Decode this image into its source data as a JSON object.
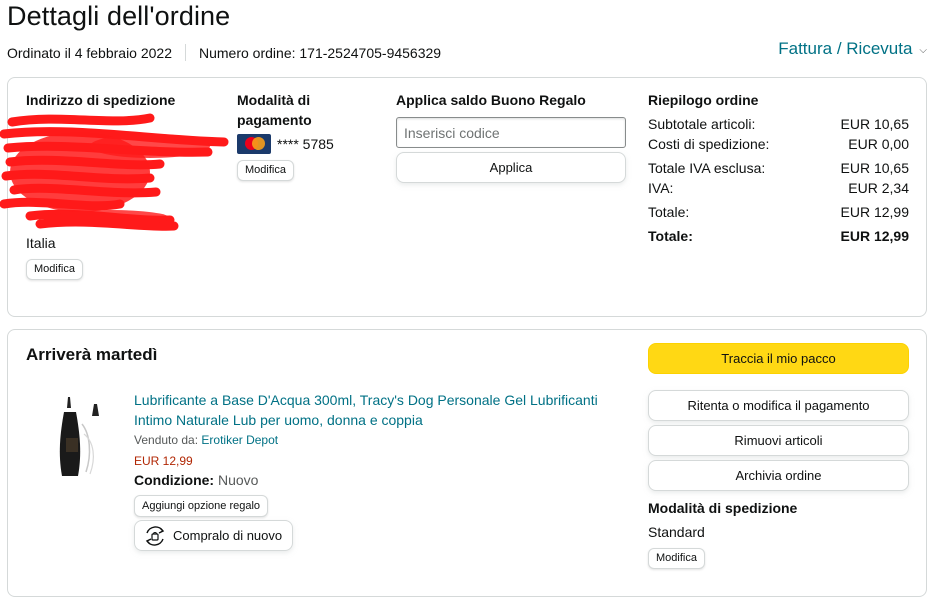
{
  "page": {
    "title": "Dettagli dell'ordine"
  },
  "order_meta": {
    "ordered_on": "Ordinato il 4 febbraio 2022",
    "order_number": "Numero ordine: 171-2524705-9456329",
    "invoice_link": "Fattura / Ricevuta"
  },
  "shipping_address": {
    "heading": "Indirizzo di spedizione",
    "country": "Italia",
    "edit_label": "Modifica"
  },
  "payment": {
    "heading": "Modalità di pagamento",
    "card_icon": "mastercard-icon",
    "card_masked": "**** 5785",
    "edit_label": "Modifica"
  },
  "gift_card": {
    "heading": "Applica saldo Buono Regalo",
    "placeholder": "Inserisci codice",
    "apply_label": "Applica"
  },
  "summary": {
    "heading": "Riepilogo ordine",
    "rows": [
      {
        "label": "Subtotale articoli:",
        "value": "EUR 10,65"
      },
      {
        "label": "Costi di spedizione:",
        "value": "EUR 0,00"
      },
      {
        "label": "Totale IVA esclusa:",
        "value": "EUR 10,65"
      },
      {
        "label": "IVA:",
        "value": "EUR 2,34"
      },
      {
        "label": "Totale:",
        "value": "EUR 12,99"
      },
      {
        "label": "Totale:",
        "value": "EUR 12,99"
      }
    ]
  },
  "shipment": {
    "heading": "Arriverà martedì",
    "product": {
      "title": "Lubrificante a Base D'Acqua 300ml, Tracy's Dog Personale Gel Lubrificanti Intimo Naturale Lub per uomo, donna e coppia",
      "sold_by_label": "Venduto da:",
      "seller": "Erotiker Depot",
      "price": "EUR 12,99",
      "condition_label": "Condizione:",
      "condition_value": "Nuovo",
      "gift_option_label": "Aggiungi opzione regalo",
      "buy_again_label": "Compralo di nuovo"
    },
    "actions": {
      "track": "Traccia il mio pacco",
      "retry_payment": "Ritenta o modifica il pagamento",
      "remove_items": "Rimuovi articoli",
      "archive": "Archivia ordine"
    },
    "shipping_method": {
      "heading": "Modalità di spedizione",
      "value": "Standard",
      "edit_label": "Modifica"
    }
  },
  "colors": {
    "link": "#007185",
    "price": "#b12704",
    "primary_button": "#ffd814",
    "redaction": "#ff0000",
    "border": "#d5d9d9"
  }
}
